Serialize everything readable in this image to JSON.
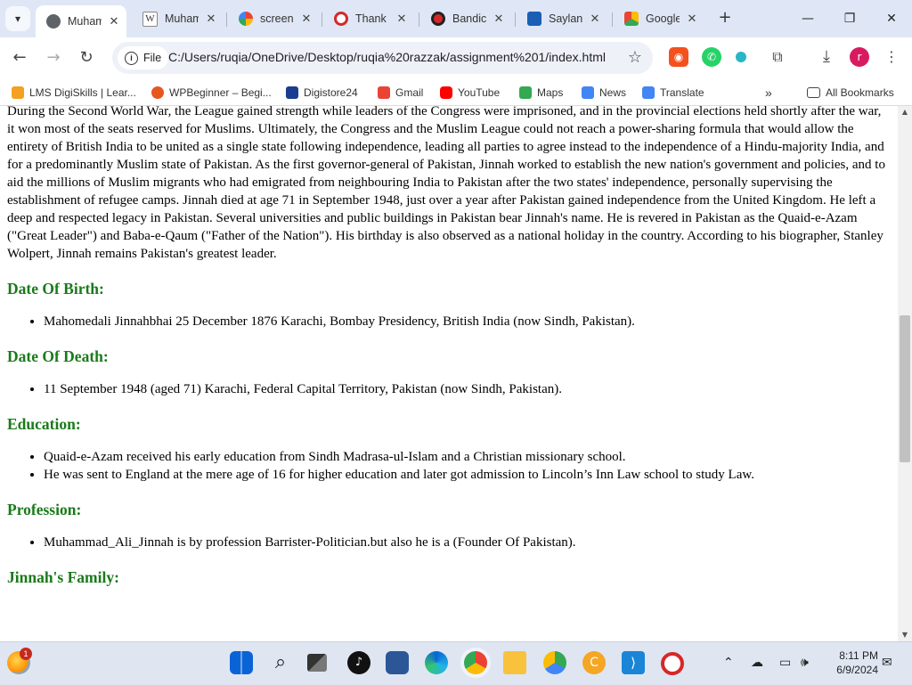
{
  "tabs": [
    {
      "label": "Muhammad Ali Jinnah",
      "favicon": "globe-icon",
      "active": true
    },
    {
      "label": "Muhammad Ali Jinnah - Wikipedia",
      "favicon": "wikipedia-icon"
    },
    {
      "label": "screenshot - Google Search",
      "favicon": "google-icon"
    },
    {
      "label": "Thank you",
      "favicon": "red-record-icon"
    },
    {
      "label": "Bandicam",
      "favicon": "bandicam-icon"
    },
    {
      "label": "Saylani",
      "favicon": "saylani-icon"
    },
    {
      "label": "Google Drive",
      "favicon": "drive-icon"
    }
  ],
  "toolbar": {
    "site_chip": "File",
    "url": "C:/Users/ruqia/OneDrive/Desktop/ruqia%20razzak/assignment%201/index.html",
    "profile_initial": "r"
  },
  "bookmarks": [
    {
      "label": "LMS DigiSkills | Lear...",
      "color": "#f4a020"
    },
    {
      "label": "WPBeginner – Begi...",
      "color": "#e8571c"
    },
    {
      "label": "Digistore24",
      "color": "#1a3d8f"
    },
    {
      "label": "Gmail",
      "color": "#ea4335"
    },
    {
      "label": "YouTube",
      "color": "#ff0000"
    },
    {
      "label": "Maps",
      "color": "#34a853"
    },
    {
      "label": "News",
      "color": "#4285f4"
    },
    {
      "label": "Translate",
      "color": "#4285f4"
    }
  ],
  "all_bookmarks_label": "All Bookmarks",
  "content": {
    "intro": "During the Second World War, the League gained strength while leaders of the Congress were imprisoned, and in the provincial elections held shortly after the war, it won most of the seats reserved for Muslims. Ultimately, the Congress and the Muslim League could not reach a power-sharing formula that would allow the entirety of British India to be united as a single state following independence, leading all parties to agree instead to the independence of a Hindu-majority India, and for a predominantly Muslim state of Pakistan. As the first governor-general of Pakistan, Jinnah worked to establish the new nation's government and policies, and to aid the millions of Muslim migrants who had emigrated from neighbouring India to Pakistan after the two states' independence, personally supervising the establishment of refugee camps. Jinnah died at age 71 in September 1948, just over a year after Pakistan gained independence from the United Kingdom. He left a deep and respected legacy in Pakistan. Several universities and public buildings in Pakistan bear Jinnah's name. He is revered in Pakistan as the Quaid-e-Azam (\"Great Leader\") and Baba-e-Qaum (\"Father of the Nation\"). His birthday is also observed as a national holiday in the country. According to his biographer, Stanley Wolpert, Jinnah remains Pakistan's greatest leader.",
    "dob_heading": "Date Of Birth:",
    "dob": "Mahomedali Jinnahbhai 25 December 1876 Karachi, Bombay Presidency, British India (now Sindh, Pakistan).",
    "dod_heading": "Date Of Death:",
    "dod": "11 September 1948 (aged 71) Karachi, Federal Capital Territory, Pakistan (now Sindh, Pakistan).",
    "edu_heading": "Education:",
    "edu": [
      "Quaid-e-Azam received his early education from Sindh Madrasa-ul-Islam and a Christian missionary school.",
      "He was sent to England at the mere age of 16 for higher education and later got admission to Lincoln’s Inn Law school to study Law."
    ],
    "prof_heading": "Profession:",
    "prof": "Muhammad_Ali_Jinnah is by profession Barrister-Politician.but also he is a (Founder Of Pakistan).",
    "family_heading": "Jinnah's Family:"
  },
  "taskbar": {
    "weather_badge": "1",
    "time": "8:11 PM",
    "date": "6/9/2024"
  },
  "colors": {
    "heading": "#1a7a1a",
    "tabstrip": "#dfe7f6",
    "taskbar": "#dfe6f2"
  }
}
